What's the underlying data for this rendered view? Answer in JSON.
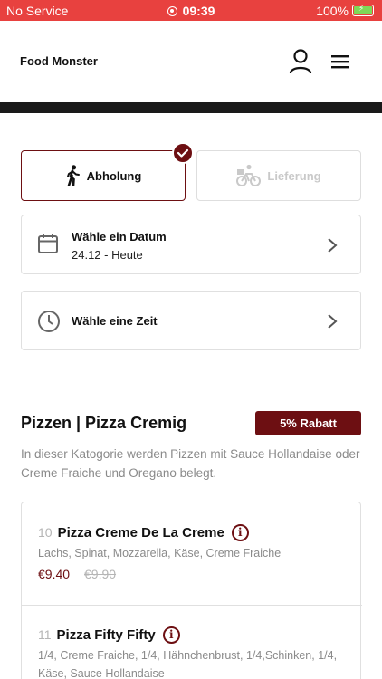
{
  "status_bar": {
    "carrier": "No Service",
    "time": "09:39",
    "battery": "100%"
  },
  "header": {
    "brand": "Food Monster"
  },
  "order_type": {
    "pickup_label": "Abholung",
    "delivery_label": "Lieferung",
    "selected": "pickup"
  },
  "date_picker": {
    "title": "Wähle ein Datum",
    "value": "24.12 - Heute"
  },
  "time_picker": {
    "title": "Wähle eine Zeit"
  },
  "category": {
    "title": "Pizzen | Pizza Cremig",
    "discount": "5% Rabatt",
    "description": "In dieser Katogorie werden Pizzen mit Sauce Hollandaise oder Creme Fraiche und Oregano belegt.",
    "items": [
      {
        "number": "10",
        "name": "Pizza Creme De La Creme",
        "ingredients": "Lachs, Spinat, Mozzarella, Käse, Creme Fraiche",
        "price": "€9.40",
        "old_price": "€9.90"
      },
      {
        "number": "11",
        "name": "Pizza Fifty Fifty",
        "ingredients": "1/4, Creme Fraiche, 1/4, Hähnchenbrust, 1/4,Schinken, 1/4, Käse, Sauce Hollandaise"
      }
    ]
  },
  "colors": {
    "status_bar": "#e8413f",
    "accent": "#6d0f12",
    "muted_text": "#8a8a8a"
  }
}
